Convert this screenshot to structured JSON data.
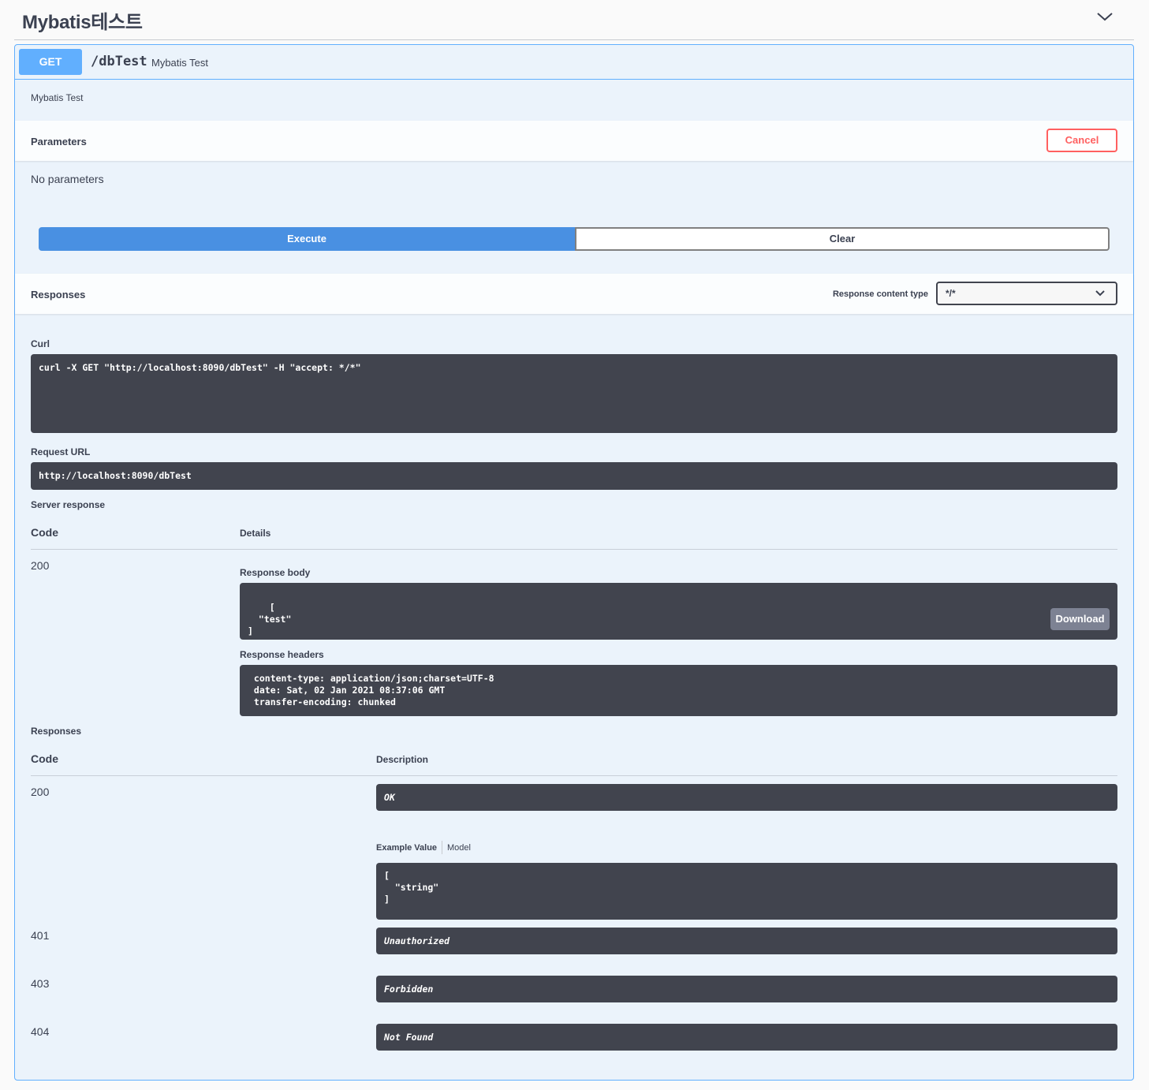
{
  "tag": {
    "title": "Mybatis테스트"
  },
  "operation": {
    "method": "GET",
    "path": "/dbTest",
    "summary": "Mybatis Test",
    "description": "Mybatis Test"
  },
  "parameters": {
    "title": "Parameters",
    "cancel_label": "Cancel",
    "empty_text": "No parameters"
  },
  "actions": {
    "execute_label": "Execute",
    "clear_label": "Clear"
  },
  "responses_header": {
    "title": "Responses",
    "content_type_label": "Response content type",
    "content_type_value": "*/*"
  },
  "curl": {
    "label": "Curl",
    "command": "curl -X GET \"http://localhost:8090/dbTest\" -H \"accept: */*\""
  },
  "request_url": {
    "label": "Request URL",
    "value": "http://localhost:8090/dbTest"
  },
  "server_response": {
    "label": "Server response",
    "col_code": "Code",
    "col_details": "Details",
    "code": "200",
    "body_label": "Response body",
    "body": "[\n  \"test\"\n]",
    "download_label": "Download",
    "headers_label": "Response headers",
    "headers": " content-type: application/json;charset=UTF-8\n date: Sat, 02 Jan 2021 08:37:06 GMT\n transfer-encoding: chunked"
  },
  "responses": {
    "label": "Responses",
    "col_code": "Code",
    "col_description": "Description",
    "example_tab": "Example Value",
    "model_tab": "Model",
    "example_value": "[\n  \"string\"\n]",
    "items": [
      {
        "code": "200",
        "description": "OK"
      },
      {
        "code": "401",
        "description": "Unauthorized"
      },
      {
        "code": "403",
        "description": "Forbidden"
      },
      {
        "code": "404",
        "description": "Not Found"
      }
    ]
  },
  "icons": {
    "collapse": "chevron-down-icon",
    "select": "chevron-down-icon"
  },
  "colors": {
    "get_method": "#61affe",
    "opblock_bg": "#ebf3fb",
    "execute": "#4990e2",
    "cancel": "#ff6060",
    "code_bg": "#41444e"
  }
}
